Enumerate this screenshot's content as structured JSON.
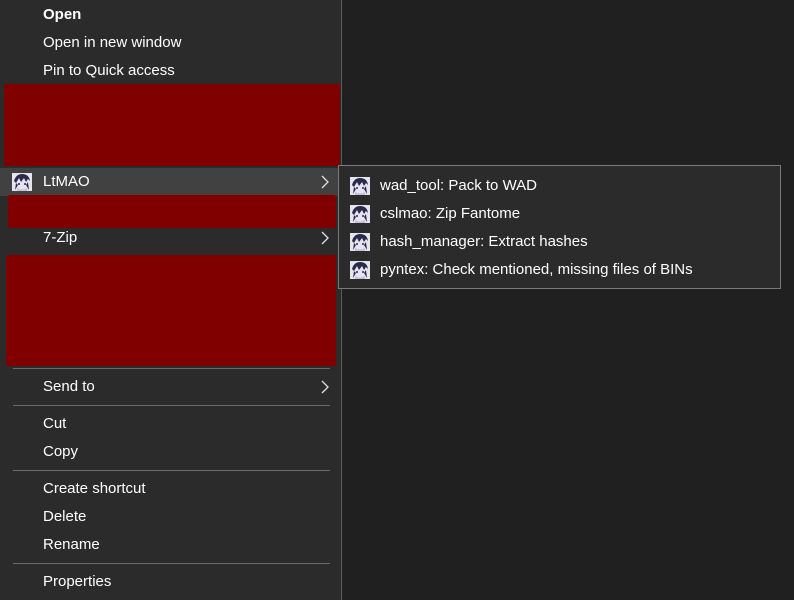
{
  "context_menu": {
    "items": {
      "open": "Open",
      "open_new_window": "Open in new window",
      "pin_quick_access": "Pin to Quick access",
      "ltmao": "LtMAO",
      "seven_zip": "7-Zip",
      "send_to": "Send to",
      "cut": "Cut",
      "copy": "Copy",
      "create_shortcut": "Create shortcut",
      "delete": "Delete",
      "rename": "Rename",
      "properties": "Properties"
    },
    "redaction_color": "#800000"
  },
  "ltmao_submenu": {
    "items": [
      {
        "label": "wad_tool: Pack to WAD",
        "icon": "ltmao-app-icon"
      },
      {
        "label": "cslmao: Zip Fantome",
        "icon": "ltmao-app-icon"
      },
      {
        "label": "hash_manager: Extract hashes",
        "icon": "ltmao-app-icon"
      },
      {
        "label": "pyntex: Check mentioned, missing files of BINs",
        "icon": "ltmao-app-icon"
      }
    ]
  }
}
